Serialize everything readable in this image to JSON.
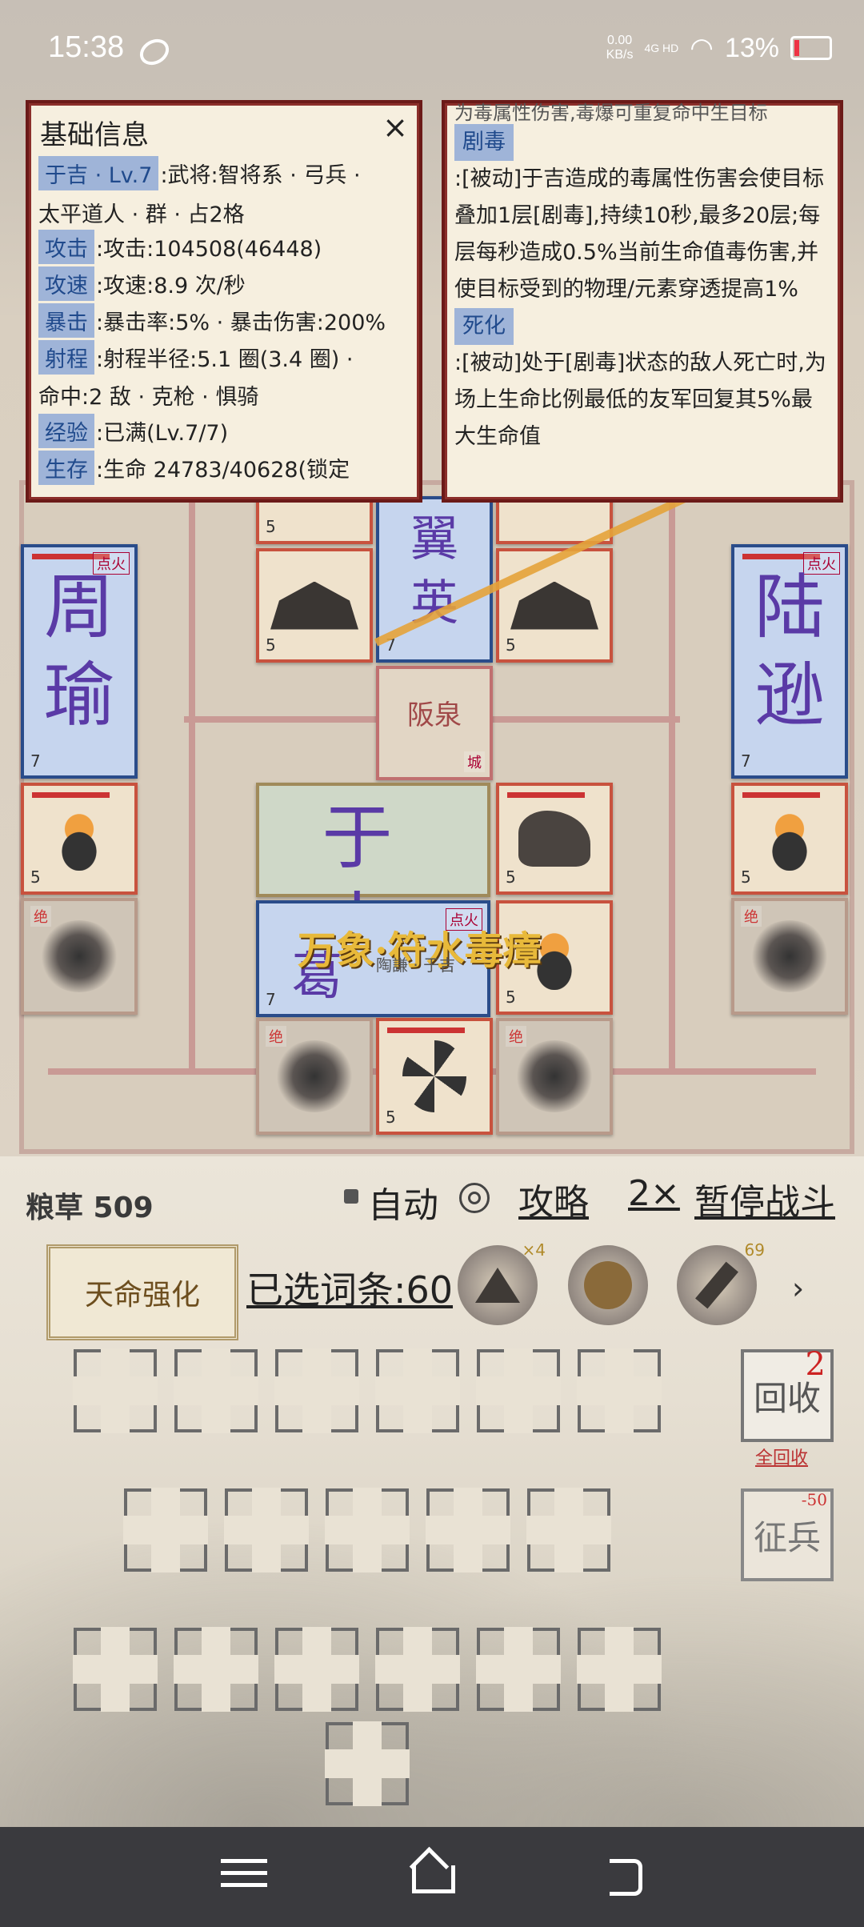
{
  "status_bar": {
    "time": "15:38",
    "net_speed": "0.00",
    "net_unit": "KB/s",
    "signal": "4G HD",
    "battery": "13%"
  },
  "board": {
    "cards": {
      "zhouyu": "周\n瑜",
      "luxun": "陆\n逊",
      "fire_tag": "点火",
      "yuji_top": "于 吉",
      "ge_label": "葛",
      "huan_label": "阪泉",
      "huan_sub": "城",
      "jue": "绝",
      "center_small": "翼\n英"
    },
    "spell": "万象·符水毒瘴",
    "spell_sub": "陶謙 · 于吉"
  },
  "info_left": {
    "title": "基础信息",
    "close": "×",
    "rows": [
      {
        "chip": "于吉 · Lv.7",
        "text": ":武将:智将系 · 弓兵 ·"
      },
      {
        "chip": "",
        "text": "太平道人 · 群 · 占2格"
      },
      {
        "chip": "攻击",
        "text": ":攻击:104508(46448)"
      },
      {
        "chip": "攻速",
        "text": ":攻速:8.9 次/秒"
      },
      {
        "chip": "暴击",
        "text": ":暴击率:5% · 暴击伤害:200%"
      },
      {
        "chip": "射程",
        "text": ":射程半径:5.1 圈(3.4 圈) ·"
      },
      {
        "chip": "",
        "text": "命中:2 敌 · 克枪 · 惧骑"
      },
      {
        "chip": "经验",
        "text": ":已满(Lv.7/7)"
      },
      {
        "chip": "生存",
        "text": ":生命 24783/40628(锁定"
      }
    ]
  },
  "info_right": {
    "top_cut": "为毒属性伤害,毒爆可重复命中生目标",
    "skill1_name": "剧毒",
    "skill1_text": ":[被动]于吉造成的毒属性伤害会使目标叠加1层[剧毒],持续10秒,最多20层;每层每秒造成0.5%当前生命值毒伤害,并使目标受到的物理/元素穿透提高1%",
    "skill2_name": "死化",
    "skill2_text": ":[被动]处于[剧毒]状态的敌人死亡时,为场上生命比例最低的友军回复其5%最大生命值"
  },
  "controls": {
    "grain": "粮草 509",
    "auto": "自动",
    "guide": "攻略",
    "speed": "2×",
    "pause": "暂停战斗",
    "destiny": "天命强化",
    "selected": "已选词条:60",
    "relic1_count": "×4",
    "relic3_count": "69",
    "more": "›",
    "recycle": "回收",
    "recycle_count": "2",
    "recycle_all": "全回收",
    "enlist": "征兵",
    "enlist_cost": "-50"
  },
  "colors": {
    "panel_border": "#6b1a18",
    "chip_bg": "#9fb4d8",
    "spell_gold": "#e8b93a"
  },
  "icons": [
    "menu-icon",
    "home-icon",
    "back-icon",
    "settings-icon"
  ]
}
